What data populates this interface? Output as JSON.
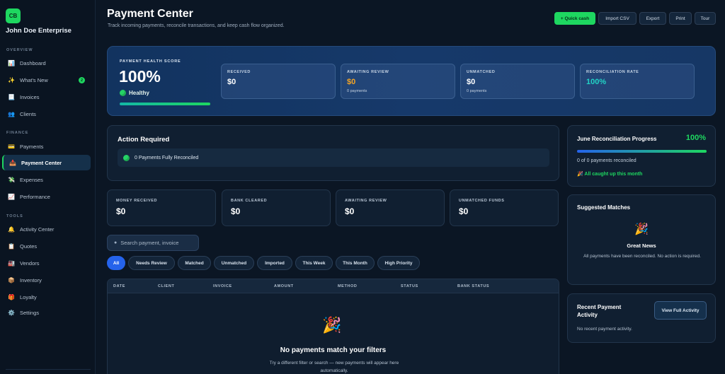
{
  "brand": {
    "initials": "CB",
    "name": "John Doe Enterprise"
  },
  "sidebar": {
    "sections": {
      "overview": "OVERVIEW",
      "finance": "FINANCE",
      "tools": "TOOLS"
    },
    "items": [
      {
        "label": "Dashboard",
        "icon": "📊"
      },
      {
        "label": "What's New",
        "icon": "✨",
        "badge": "2"
      },
      {
        "label": "Invoices",
        "icon": "📃"
      },
      {
        "label": "Clients",
        "icon": "👥"
      },
      {
        "label": "Payments",
        "icon": "💳"
      },
      {
        "label": "Payment Center",
        "icon": "📥"
      },
      {
        "label": "Expenses",
        "icon": "💸"
      },
      {
        "label": "Performance",
        "icon": "📈"
      },
      {
        "label": "Activity Center",
        "icon": "🔔"
      },
      {
        "label": "Quotes",
        "icon": "📋"
      },
      {
        "label": "Vendors",
        "icon": "🏭"
      },
      {
        "label": "Inventory",
        "icon": "📦"
      },
      {
        "label": "Loyalty",
        "icon": "🎁"
      },
      {
        "label": "Settings",
        "icon": "⚙️"
      }
    ]
  },
  "header": {
    "title": "Payment Center",
    "subtitle": "Track incoming payments, reconcile transactions, and keep cash flow organized.",
    "buttons": {
      "quick_cash": "+ Quick cash",
      "import": "Import CSV",
      "export": "Export",
      "print": "Print",
      "tour": "Tour"
    }
  },
  "health": {
    "label": "PAYMENT HEALTH SCORE",
    "score": "100%",
    "status": "Healthy",
    "progress": 1.0,
    "stats": [
      {
        "label": "RECEIVED",
        "value": "$0",
        "sub": ""
      },
      {
        "label": "AWAITING REVIEW",
        "value": "$0",
        "sub": "0 payments"
      },
      {
        "label": "UNMATCHED",
        "value": "$0",
        "sub": "0 payments"
      },
      {
        "label": "RECONCILIATION RATE",
        "value": "100%",
        "sub": ""
      }
    ]
  },
  "action": {
    "title": "Action Required",
    "row": "0 Payments Fully Reconciled"
  },
  "metrics": [
    {
      "label": "MONEY RECEIVED",
      "value": "$0"
    },
    {
      "label": "BANK CLEARED",
      "value": "$0"
    },
    {
      "label": "AWAITING REVIEW",
      "value": "$0"
    },
    {
      "label": "UNMATCHED FUNDS",
      "value": "$0"
    }
  ],
  "search": {
    "placeholder": "Search payment, invoice"
  },
  "filters": [
    "All",
    "Needs Review",
    "Matched",
    "Unmatched",
    "Imported",
    "This Week",
    "This Month",
    "High Priority"
  ],
  "table": {
    "columns": [
      "DATE",
      "CLIENT",
      "INVOICE",
      "AMOUNT",
      "METHOD",
      "STATUS",
      "BANK STATUS"
    ],
    "empty_icon": "🎉",
    "empty_title": "No payments match your filters",
    "empty_text": "Try a different filter or search — new payments will appear here automatically."
  },
  "reconciliation": {
    "title": "June Reconciliation Progress",
    "percent": "100%",
    "progress": 1.0,
    "count": "0 of 0 payments reconciled",
    "status": "🎉 All caught up this month"
  },
  "suggested": {
    "title": "Suggested Matches",
    "icon": "🎉",
    "heading": "Great News",
    "text": "All payments have been reconciled. No action is required."
  },
  "recent": {
    "title": "Recent Payment Activity",
    "button": "View Full Activity",
    "empty": "No recent payment activity."
  },
  "colors": {
    "accent": "#1ed760",
    "primary": "#2563eb",
    "warning": "#f5a524",
    "teal": "#22d3c5"
  }
}
